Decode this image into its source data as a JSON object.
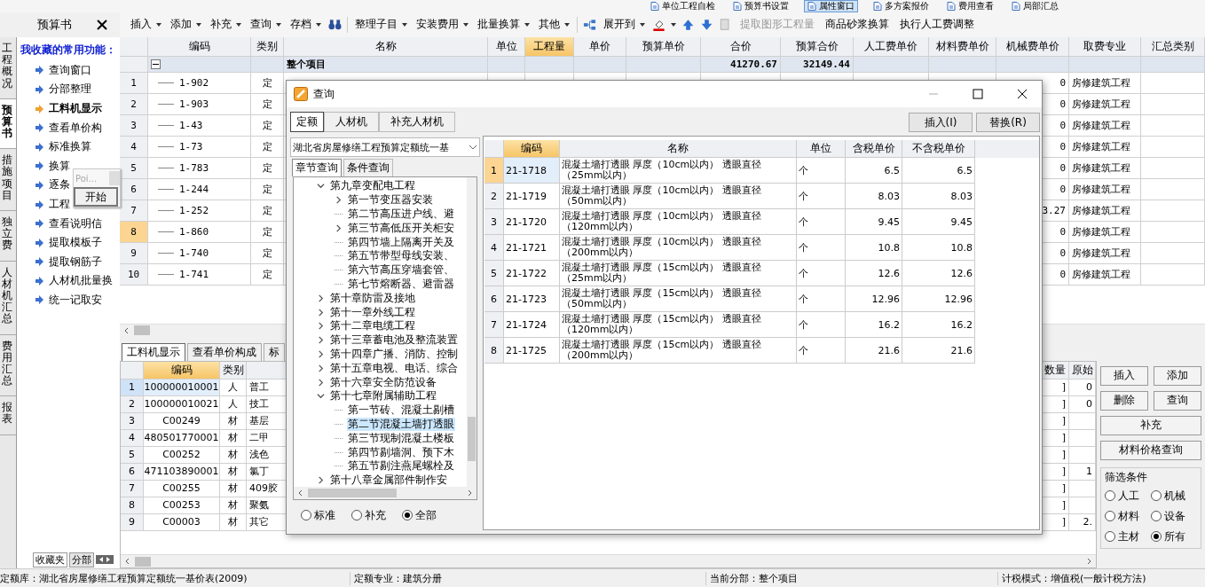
{
  "toolbar_top": [
    {
      "label": "单位工程自检",
      "pressed": false
    },
    {
      "label": "预算书设置",
      "pressed": false
    },
    {
      "label": "属性窗口",
      "pressed": true
    },
    {
      "label": "多方案报价",
      "pressed": false
    },
    {
      "label": "费用查看",
      "pressed": false
    },
    {
      "label": "局部汇总",
      "pressed": false
    }
  ],
  "toolbar": {
    "menus": [
      "插入",
      "添加",
      "补充",
      "查询",
      "存档",
      "整理子目",
      "安装费用",
      "批量换算",
      "其他"
    ],
    "expand_menu": "展开到",
    "buttons": [
      {
        "label": "提取图形工程量",
        "disabled": true
      },
      {
        "label": "商品砂浆换算",
        "disabled": false
      },
      {
        "label": "执行人工费调整",
        "disabled": false
      }
    ]
  },
  "side_tabs": [
    {
      "label": "工程概况",
      "selected": false
    },
    {
      "label": "预算书",
      "selected": true
    },
    {
      "label": "措施项目",
      "selected": false
    },
    {
      "label": "独立费",
      "selected": false
    },
    {
      "label": "人材机汇总",
      "selected": false
    },
    {
      "label": "费用汇总",
      "selected": false
    },
    {
      "label": "报表",
      "selected": false
    }
  ],
  "left_panel": {
    "title": "预算书",
    "favorites_title": "我收藏的常用功能：",
    "items": [
      {
        "label": "查询窗口",
        "selected": false
      },
      {
        "label": "分部整理",
        "selected": false
      },
      {
        "label": "工料机显示",
        "selected": true
      },
      {
        "label": "查看单价构",
        "selected": false
      },
      {
        "label": "标准换算",
        "selected": false
      },
      {
        "label": "换算",
        "selected": false
      },
      {
        "label": "逐条",
        "selected": false
      },
      {
        "label": "工程",
        "selected": false
      },
      {
        "label": "查看说明信",
        "selected": false
      },
      {
        "label": "提取模板子",
        "selected": false
      },
      {
        "label": "提取钢筋子",
        "selected": false
      },
      {
        "label": "人材机批量换",
        "selected": false
      },
      {
        "label": "统一记取安",
        "selected": false
      }
    ],
    "bottom_tabs": [
      {
        "label": "收藏夹",
        "selected": true
      },
      {
        "label": "分部",
        "selected": false
      }
    ]
  },
  "popup": {
    "title": "Poi...",
    "button": "开始"
  },
  "main_table": {
    "columns": [
      {
        "label": "编码",
        "selected": false
      },
      {
        "label": "类别",
        "selected": false
      },
      {
        "label": "名称",
        "selected": false
      },
      {
        "label": "单位",
        "selected": false
      },
      {
        "label": "工程量",
        "selected": true
      },
      {
        "label": "单价",
        "selected": false
      },
      {
        "label": "预算单价",
        "selected": false
      },
      {
        "label": "合价",
        "selected": false
      },
      {
        "label": "预算合价",
        "selected": false
      },
      {
        "label": "人工费单价",
        "selected": false
      },
      {
        "label": "材料费单价",
        "selected": false
      },
      {
        "label": "机械费单价",
        "selected": false
      },
      {
        "label": "取费专业",
        "selected": false
      },
      {
        "label": "汇总类别",
        "selected": false
      }
    ],
    "summary_row": {
      "label": "整个项目",
      "expanded": true,
      "total": "41270.67",
      "budget_total": "32149.44"
    },
    "rows": [
      {
        "num": "1",
        "code": "1-902",
        "type": "定",
        "machine_price": "0",
        "fee_category": "房修建筑工程",
        "selected": false
      },
      {
        "num": "2",
        "code": "1-903",
        "type": "定",
        "machine_price": "0",
        "fee_category": "房修建筑工程",
        "selected": false
      },
      {
        "num": "3",
        "code": "1-43",
        "type": "定",
        "machine_price": "0",
        "fee_category": "房修建筑工程",
        "selected": false
      },
      {
        "num": "4",
        "code": "1-73",
        "type": "定",
        "machine_price": "0",
        "fee_category": "房修建筑工程",
        "selected": false
      },
      {
        "num": "5",
        "code": "1-783",
        "type": "定",
        "machine_price": "0",
        "fee_category": "房修建筑工程",
        "selected": false
      },
      {
        "num": "6",
        "code": "1-244",
        "type": "定",
        "machine_price": "0",
        "fee_category": "房修建筑工程",
        "selected": false
      },
      {
        "num": "7",
        "code": "1-252",
        "type": "定",
        "machine_price": "3.27",
        "fee_category": "房修建筑工程",
        "selected": false
      },
      {
        "num": "8",
        "code": "1-860",
        "type": "定",
        "machine_price": "0",
        "fee_category": "房修建筑工程",
        "selected": true
      },
      {
        "num": "9",
        "code": "1-740",
        "type": "定",
        "machine_price": "0",
        "fee_category": "房修建筑工程",
        "selected": false
      },
      {
        "num": "10",
        "code": "1-741",
        "type": "定",
        "machine_price": "0",
        "fee_category": "房修建筑工程",
        "selected": false
      }
    ]
  },
  "detail_tabs": [
    {
      "label": "工料机显示",
      "selected": true
    },
    {
      "label": "查看单价构成",
      "selected": false
    },
    {
      "label": "标",
      "selected": false
    }
  ],
  "detail_table": {
    "columns": [
      "编码",
      "类别",
      "数量",
      "原始"
    ],
    "rows": [
      {
        "num": "1",
        "code": "100000010001",
        "type": "人",
        "name": "普工",
        "qty": "]",
        "orig": "0",
        "selected": true
      },
      {
        "num": "2",
        "code": "100000010021",
        "type": "人",
        "name": "技工",
        "qty": "]",
        "orig": "0",
        "selected": false
      },
      {
        "num": "3",
        "code": "C00249",
        "type": "材",
        "name": "基层",
        "qty": "]",
        "selected": false
      },
      {
        "num": "4",
        "code": "480501770001",
        "type": "材",
        "name": "二甲",
        "qty": "]",
        "selected": false
      },
      {
        "num": "5",
        "code": "C00252",
        "type": "材",
        "name": "浅色",
        "qty": "]",
        "selected": false
      },
      {
        "num": "6",
        "code": "471103890001",
        "type": "材",
        "name": "氯丁",
        "qty": "]",
        "orig": "1",
        "selected": false
      },
      {
        "num": "7",
        "code": "C00255",
        "type": "材",
        "name": "409胶",
        "qty": "]",
        "selected": false
      },
      {
        "num": "8",
        "code": "C00253",
        "type": "材",
        "name": "聚氨",
        "qty": "]",
        "selected": false
      },
      {
        "num": "9",
        "code": "C00003",
        "type": "材",
        "name": "其它",
        "qty": "]",
        "orig": "2.",
        "selected": false
      }
    ]
  },
  "actions": [
    "插入",
    "添加",
    "删除",
    "查询",
    "补充",
    "材料价格查询"
  ],
  "filter": {
    "title": "筛选条件",
    "options": [
      {
        "label": "人工",
        "selected": false
      },
      {
        "label": "机械",
        "selected": false
      },
      {
        "label": "材料",
        "selected": false
      },
      {
        "label": "设备",
        "selected": false
      },
      {
        "label": "主材",
        "selected": false
      },
      {
        "label": "所有",
        "selected": true
      }
    ]
  },
  "status_bar": [
    "定额库：湖北省房屋修缮工程预算定额统一基价表(2009)",
    "定额专业：建筑分册",
    "当前分部：整个项目",
    "计税模式：增值税(一般计税方法)"
  ],
  "dialog": {
    "title": "查询",
    "tabs": [
      {
        "label": "定额",
        "selected": true
      },
      {
        "label": "人材机",
        "selected": false
      },
      {
        "label": "补充人材机",
        "selected": false
      }
    ],
    "buttons": [
      "插入(I)",
      "替换(R)"
    ],
    "library": "湖北省房屋修缮工程预算定额统一基",
    "query_tabs": [
      {
        "label": "章节查询",
        "selected": true
      },
      {
        "label": "条件查询",
        "selected": false
      }
    ],
    "tree": [
      {
        "label": "第九章变配电工程",
        "expanded": true,
        "selected": false,
        "children": [
          {
            "label": "第一节变压器安装",
            "expanded": false,
            "selected": false
          },
          {
            "label": "第二节高压进户线、避",
            "selected": false
          },
          {
            "label": "第三节高低压开关柜安",
            "expanded": false,
            "selected": false
          },
          {
            "label": "第四节墙上隔离开关及",
            "selected": false
          },
          {
            "label": "第五节带型母线安装、",
            "selected": false
          },
          {
            "label": "第六节高压穿墙套管、",
            "selected": false
          },
          {
            "label": "第七节熔断器、避雷器",
            "selected": false
          }
        ]
      },
      {
        "label": "第十章防雷及接地",
        "expanded": false,
        "selected": false
      },
      {
        "label": "第十一章外线工程",
        "expanded": false,
        "selected": false
      },
      {
        "label": "第十二章电缆工程",
        "expanded": false,
        "selected": false
      },
      {
        "label": "第十三章蓄电池及整流装置",
        "expanded": false,
        "selected": false
      },
      {
        "label": "第十四章广播、消防、控制",
        "expanded": false,
        "selected": false
      },
      {
        "label": "第十五章电视、电话、综合",
        "expanded": false,
        "selected": false
      },
      {
        "label": "第十六章安全防范设备",
        "expanded": false,
        "selected": false
      },
      {
        "label": "第十七章附属辅助工程",
        "expanded": true,
        "selected": false,
        "children": [
          {
            "label": "第一节砖、混凝土剔槽",
            "selected": false
          },
          {
            "label": "第二节混凝土墙打透眼",
            "selected": true
          },
          {
            "label": "第三节现制混凝土楼板",
            "selected": false
          },
          {
            "label": "第四节剔墙洞、预下木",
            "selected": false
          },
          {
            "label": "第五节剔注燕尾螺栓及",
            "selected": false
          }
        ]
      },
      {
        "label": "第十八章金属部件制作安",
        "expanded": false,
        "selected": false
      }
    ],
    "scope": [
      {
        "label": "标准",
        "selected": false
      },
      {
        "label": "补充",
        "selected": false
      },
      {
        "label": "全部",
        "selected": true
      }
    ],
    "table": {
      "columns": [
        {
          "label": "编码",
          "selected": true
        },
        {
          "label": "名称",
          "selected": false
        },
        {
          "label": "单位",
          "selected": false
        },
        {
          "label": "含税单价",
          "selected": false
        },
        {
          "label": "不含税单价",
          "selected": false
        }
      ],
      "rows": [
        {
          "num": "1",
          "code": "21-1718",
          "name": "混凝土墙打透眼 厚度（10cm以内） 透眼直径（25mm以内）",
          "unit": "个",
          "tax_price": "6.5",
          "price": "6.5",
          "selected": true
        },
        {
          "num": "2",
          "code": "21-1719",
          "name": "混凝土墙打透眼 厚度（10cm以内） 透眼直径（50mm以内）",
          "unit": "个",
          "tax_price": "8.03",
          "price": "8.03",
          "selected": false
        },
        {
          "num": "3",
          "code": "21-1720",
          "name": "混凝土墙打透眼 厚度（10cm以内） 透眼直径（120mm以内）",
          "unit": "个",
          "tax_price": "9.45",
          "price": "9.45",
          "selected": false
        },
        {
          "num": "4",
          "code": "21-1721",
          "name": "混凝土墙打透眼 厚度（10cm以内） 透眼直径（200mm以内）",
          "unit": "个",
          "tax_price": "10.8",
          "price": "10.8",
          "selected": false
        },
        {
          "num": "5",
          "code": "21-1722",
          "name": "混凝土墙打透眼 厚度（15cm以内） 透眼直径（25mm以内）",
          "unit": "个",
          "tax_price": "12.6",
          "price": "12.6",
          "selected": false
        },
        {
          "num": "6",
          "code": "21-1723",
          "name": "混凝土墙打透眼 厚度（15cm以内） 透眼直径（50mm以内）",
          "unit": "个",
          "tax_price": "12.96",
          "price": "12.96",
          "selected": false
        },
        {
          "num": "7",
          "code": "21-1724",
          "name": "混凝土墙打透眼 厚度（15cm以内） 透眼直径（120mm以内）",
          "unit": "个",
          "tax_price": "16.2",
          "price": "16.2",
          "selected": false
        },
        {
          "num": "8",
          "code": "21-1725",
          "name": "混凝土墙打透眼 厚度（15cm以内） 透眼直径（200mm以内）",
          "unit": "个",
          "tax_price": "21.6",
          "price": "21.6",
          "selected": false
        }
      ]
    }
  }
}
